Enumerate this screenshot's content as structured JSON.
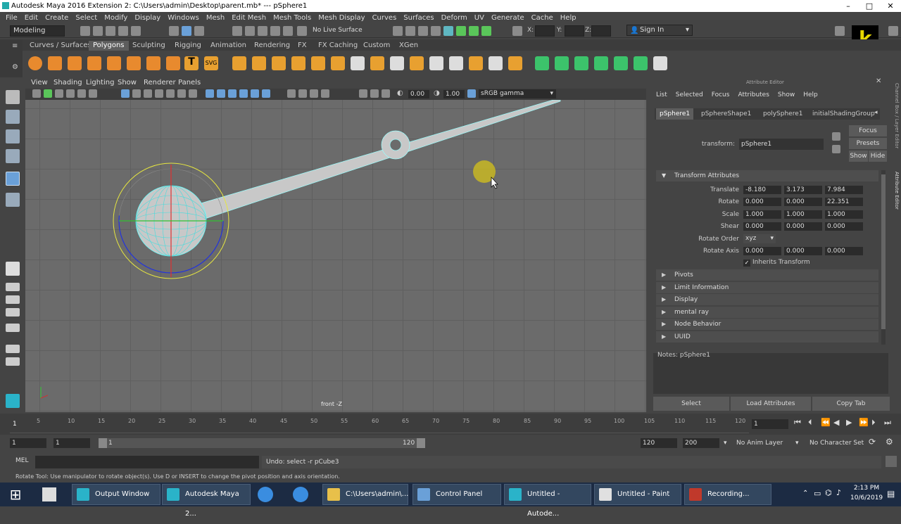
{
  "window": {
    "title": "Autodesk Maya 2016 Extension 2: C:\\Users\\admin\\Desktop\\parent.mb*   ---   pSphere1"
  },
  "menubar": [
    "File",
    "Edit",
    "Create",
    "Select",
    "Modify",
    "Display",
    "Windows",
    "Mesh",
    "Edit Mesh",
    "Mesh Tools",
    "Mesh Display",
    "Curves",
    "Surfaces",
    "Deform",
    "UV",
    "Generate",
    "Cache",
    "Help"
  ],
  "statusline": {
    "mode": "Modeling",
    "live_surface": "No Live Surface",
    "x_label": "X:",
    "y_label": "Y:",
    "z_label": "Z:",
    "sign_in": "Sign In"
  },
  "shelf_tabs": [
    "Curves / Surfaces",
    "Polygons",
    "Sculpting",
    "Rigging",
    "Animation",
    "Rendering",
    "FX",
    "FX Caching",
    "Custom",
    "XGen"
  ],
  "shelf_active": "Polygons",
  "panel_menu": [
    "View",
    "Shading",
    "Lighting",
    "Show",
    "Renderer",
    "Panels"
  ],
  "panel_toolbar": {
    "exposure": "0.00",
    "gamma": "1.00",
    "colorspace": "sRGB gamma"
  },
  "viewport": {
    "camera_label": "front -Z"
  },
  "attribute_editor": {
    "title": "Attribute Editor",
    "menu": [
      "List",
      "Selected",
      "Focus",
      "Attributes",
      "Show",
      "Help"
    ],
    "tabs": [
      "pSphere1",
      "pSphereShape1",
      "polySphere1",
      "initialShadingGroup"
    ],
    "transform_label": "transform:",
    "transform_value": "pSphere1",
    "buttons": {
      "focus": "Focus",
      "presets": "Presets",
      "show": "Show",
      "hide": "Hide"
    },
    "section_transform": "Transform Attributes",
    "translate_label": "Translate",
    "translate": [
      "-8.180",
      "3.173",
      "7.984"
    ],
    "rotate_label": "Rotate",
    "rotate": [
      "0.000",
      "0.000",
      "22.351"
    ],
    "scale_label": "Scale",
    "scale": [
      "1.000",
      "1.000",
      "1.000"
    ],
    "shear_label": "Shear",
    "shear": [
      "0.000",
      "0.000",
      "0.000"
    ],
    "rotate_order_label": "Rotate Order",
    "rotate_order": "xyz",
    "rotate_axis_label": "Rotate Axis",
    "rotate_axis": [
      "0.000",
      "0.000",
      "0.000"
    ],
    "inherits_label": "Inherits Transform",
    "sections": [
      "Pivots",
      "Limit Information",
      "Display",
      "mental ray",
      "Node Behavior",
      "UUID"
    ],
    "notes": "Notes:  pSphere1",
    "bottom_buttons": [
      "Select",
      "Load Attributes",
      "Copy Tab"
    ]
  },
  "side_tabs": {
    "channel_box": "Channel Box / Layer Editor",
    "attribute_editor": "Attribute Editor"
  },
  "timeline": {
    "ticks": [
      "1",
      "5",
      "10",
      "15",
      "20",
      "25",
      "30",
      "35",
      "40",
      "45",
      "50",
      "55",
      "60",
      "65",
      "70",
      "75",
      "80",
      "85",
      "90",
      "95",
      "100",
      "105",
      "110",
      "115",
      "120"
    ],
    "current_frame": "1"
  },
  "range": {
    "start": "1",
    "playback_start": "1",
    "range_start": "1",
    "range_end": "120",
    "playback_end": "120",
    "end": "200",
    "anim_layer": "No Anim Layer",
    "character_set": "No Character Set"
  },
  "command": {
    "lang": "MEL",
    "result": "Undo: select -r pCube3"
  },
  "help_line": "Rotate Tool: Use manipulator to rotate object(s). Use D or INSERT to change the pivot position and axis orientation.",
  "taskbar": {
    "items": [
      "Output Window",
      "Autodesk Maya 2...",
      "C:\\Users\\admin\\...",
      "Control Panel",
      "Untitled - Autode...",
      "Untitled - Paint",
      "Recording..."
    ],
    "time": "2:13 PM",
    "date": "10/6/2019"
  }
}
